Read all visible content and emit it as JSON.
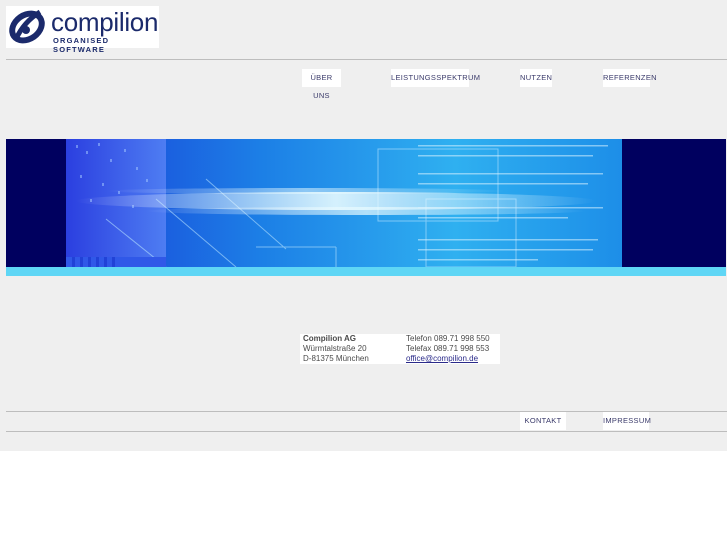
{
  "logo": {
    "name": "compilion",
    "tagline": "ORGANISED SOFTWARE"
  },
  "nav": {
    "items": [
      {
        "label": "ÜBER UNS"
      },
      {
        "label": "LEISTUNGSSPEKTRUM"
      },
      {
        "label": "NUTZEN"
      },
      {
        "label": "REFERENZEN"
      }
    ]
  },
  "address": {
    "company": "Compilion AG",
    "street": "Würmtalstraße 20",
    "city": "D-81375 München",
    "phone": "Telefon 089.71 998 550",
    "fax": "Telefax 089.71 998 553",
    "email": "office@compilion.de"
  },
  "footer": {
    "items": [
      {
        "label": "KONTAKT"
      },
      {
        "label": "IMPRESSUM"
      }
    ]
  },
  "colors": {
    "brand": "#1b2a6b",
    "banner_dark": "#00005f",
    "banner_light": "#5fd6f5"
  }
}
